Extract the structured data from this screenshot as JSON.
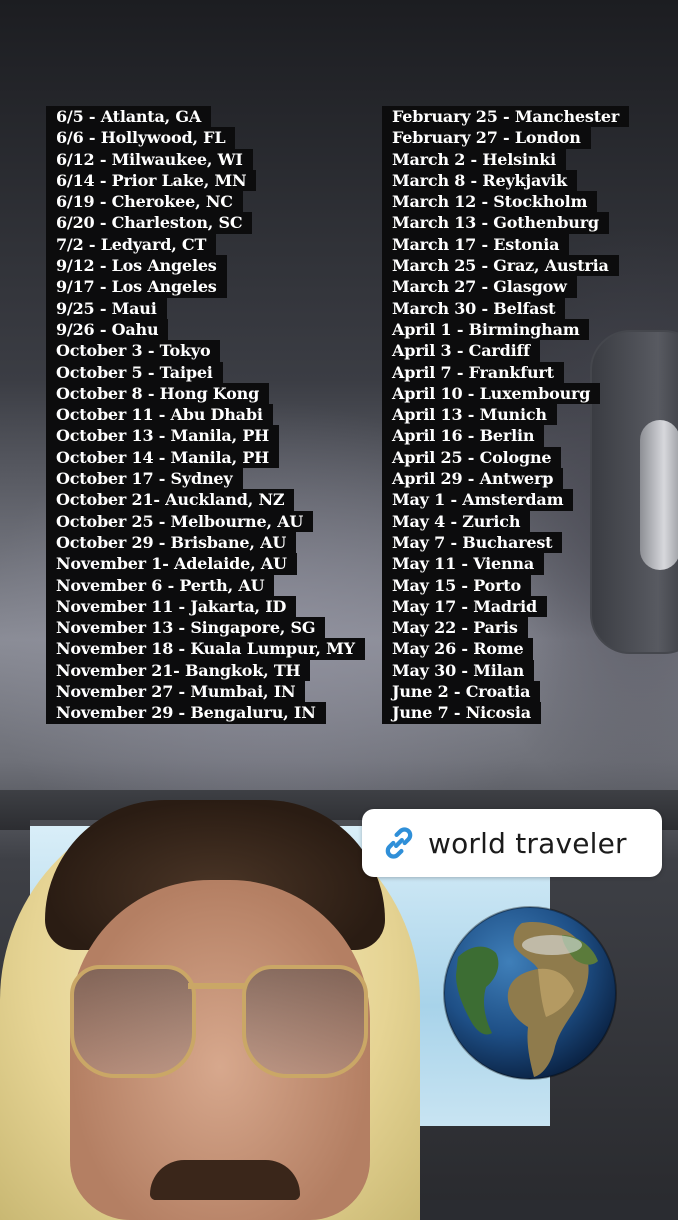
{
  "schedule_left": [
    "6/5 - Atlanta, GA",
    "6/6 - Hollywood, FL",
    "6/12 - Milwaukee, WI",
    "6/14 - Prior Lake, MN",
    "6/19 - Cherokee, NC",
    "6/20 - Charleston, SC",
    "7/2 - Ledyard, CT",
    "9/12 - Los Angeles",
    "9/17 - Los Angeles",
    "9/25 - Maui",
    "9/26 - Oahu",
    "October 3 - Tokyo",
    "October 5 - Taipei",
    "October 8 - Hong Kong",
    "October 11 - Abu Dhabi",
    "October 13 - Manila, PH",
    "October 14 - Manila, PH",
    "October 17 - Sydney",
    "October 21- Auckland, NZ",
    "October 25 - Melbourne, AU",
    "October 29 - Brisbane, AU",
    "November 1- Adelaide, AU",
    "November 6 - Perth, AU",
    "November 11 - Jakarta, ID",
    "November 13 - Singapore, SG",
    "November 18 - Kuala Lumpur, MY",
    "November 21- Bangkok, TH",
    "November 27 - Mumbai, IN",
    "November 29 - Bengaluru, IN"
  ],
  "schedule_right": [
    "February 25 - Manchester",
    "February 27 - London",
    "March 2 - Helsinki",
    "March 8 - Reykjavik",
    "March 12 - Stockholm",
    "March 13 - Gothenburg",
    "March 17 - Estonia",
    "March 25 - Graz, Austria",
    "March 27 - Glasgow",
    "March 30 - Belfast",
    "April 1 - Birmingham",
    "April 3 - Cardiff",
    "April 7 - Frankfurt",
    "April 10 - Luxembourg",
    "April 13 - Munich",
    "April 16 - Berlin",
    "April 25 - Cologne",
    "April 29 - Antwerp",
    "May 1 - Amsterdam",
    "May 4 - Zurich",
    "May 7 - Bucharest",
    "May 11 - Vienna",
    "May 15 - Porto",
    "May 17 - Madrid",
    "May 22 - Paris",
    "May 26 - Rome",
    "May 30 - Milan",
    "June 2 - Croatia",
    "June 7 - Nicosia"
  ],
  "link_sticker": {
    "icon": "link-icon",
    "label": "world traveler",
    "accent_color": "#2f8fd8"
  },
  "globe_sticker": {
    "icon": "globe-icon"
  }
}
